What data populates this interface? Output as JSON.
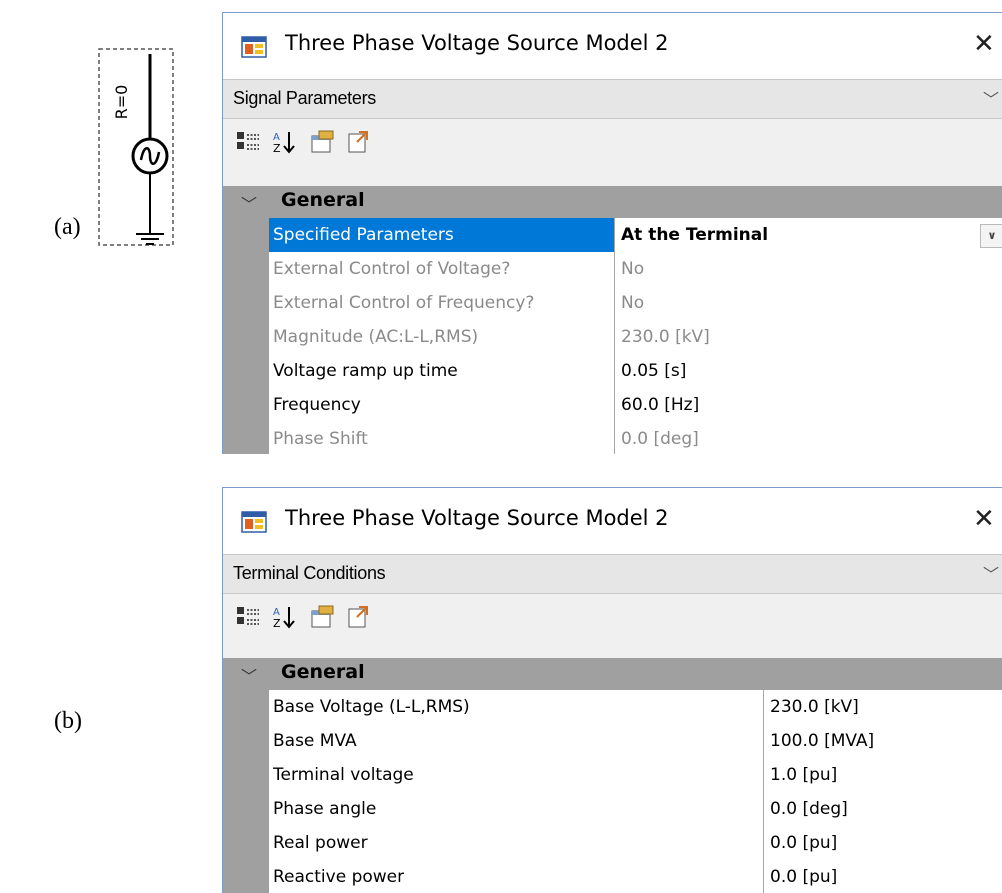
{
  "labels": {
    "a": "(a)",
    "b": "(b)"
  },
  "schematic": {
    "resistance_label": "R=0"
  },
  "window_a": {
    "title": "Three Phase Voltage Source Model 2",
    "close_glyph": "✕",
    "selector": "Signal Parameters",
    "category": "General",
    "rows": [
      {
        "name": "Specified Parameters",
        "value": "At the Terminal",
        "selected": true,
        "editable": true
      },
      {
        "name": "External Control of Voltage?",
        "value": "No",
        "editable": false
      },
      {
        "name": "External Control of Frequency?",
        "value": "No",
        "editable": false
      },
      {
        "name": "Magnitude (AC:L-L,RMS)",
        "value": "230.0 [kV]",
        "editable": false
      },
      {
        "name": "Voltage ramp up time",
        "value": "0.05 [s]",
        "editable": true
      },
      {
        "name": "Frequency",
        "value": "60.0 [Hz]",
        "editable": true
      },
      {
        "name": "Phase Shift",
        "value": "0.0 [deg]",
        "editable": false
      }
    ]
  },
  "window_b": {
    "title": "Three Phase Voltage Source Model 2",
    "close_glyph": "✕",
    "selector": "Terminal Conditions",
    "category": "General",
    "rows": [
      {
        "name": "Base Voltage (L-L,RMS)",
        "value": "230.0 [kV]"
      },
      {
        "name": "Base MVA",
        "value": "100.0 [MVA]"
      },
      {
        "name": "Terminal voltage",
        "value": "1.0 [pu]"
      },
      {
        "name": "Phase angle",
        "value": "0.0 [deg]"
      },
      {
        "name": "Real power",
        "value": "0.0 [pu]"
      },
      {
        "name": "Reactive power",
        "value": "0.0 [pu]"
      }
    ]
  },
  "colors": {
    "selection": "#0078d7",
    "gutter": "#a0a0a0",
    "readonly_text": "#8a8a8a"
  },
  "icons": [
    "categorized-view-icon",
    "alphabetical-sort-icon",
    "property-pages-icon",
    "export-icon",
    "chevron-down-icon",
    "close-icon",
    "app-icon"
  ]
}
